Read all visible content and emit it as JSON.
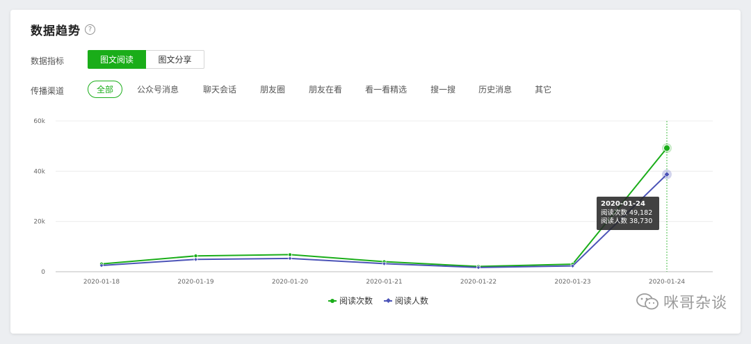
{
  "header": {
    "title": "数据趋势",
    "help_glyph": "?"
  },
  "metric": {
    "label": "数据指标",
    "options": [
      {
        "label": "图文阅读",
        "active": true
      },
      {
        "label": "图文分享",
        "active": false
      }
    ]
  },
  "channel": {
    "label": "传播渠道",
    "options": [
      {
        "label": "全部",
        "active": true
      },
      {
        "label": "公众号消息",
        "active": false
      },
      {
        "label": "聊天会话",
        "active": false
      },
      {
        "label": "朋友圈",
        "active": false
      },
      {
        "label": "朋友在看",
        "active": false
      },
      {
        "label": "看一看精选",
        "active": false
      },
      {
        "label": "搜一搜",
        "active": false
      },
      {
        "label": "历史消息",
        "active": false
      },
      {
        "label": "其它",
        "active": false
      }
    ]
  },
  "colors": {
    "accent": "#1aad19",
    "series_reads": "#1aad19",
    "series_readers": "#4b53b7"
  },
  "chart_data": {
    "type": "line",
    "x": [
      "2020-01-18",
      "2020-01-19",
      "2020-01-20",
      "2020-01-21",
      "2020-01-22",
      "2020-01-23",
      "2020-01-24"
    ],
    "y_ticks": [
      "0",
      "20k",
      "40k",
      "60k"
    ],
    "ylim": [
      0,
      60000
    ],
    "grid": true,
    "legend_position": "bottom-center",
    "series": [
      {
        "name": "阅读次数",
        "color": "#1aad19",
        "values": [
          3100,
          6300,
          6800,
          4000,
          2100,
          3000,
          49182
        ]
      },
      {
        "name": "阅读人数",
        "color": "#4b53b7",
        "values": [
          2500,
          4900,
          5300,
          3200,
          1700,
          2300,
          38730
        ]
      }
    ],
    "tooltip": {
      "date": "2020-01-24",
      "lines": [
        "阅读次数 49,182",
        "阅读人数 38,730"
      ]
    }
  },
  "watermark": {
    "text": "咪哥杂谈"
  }
}
